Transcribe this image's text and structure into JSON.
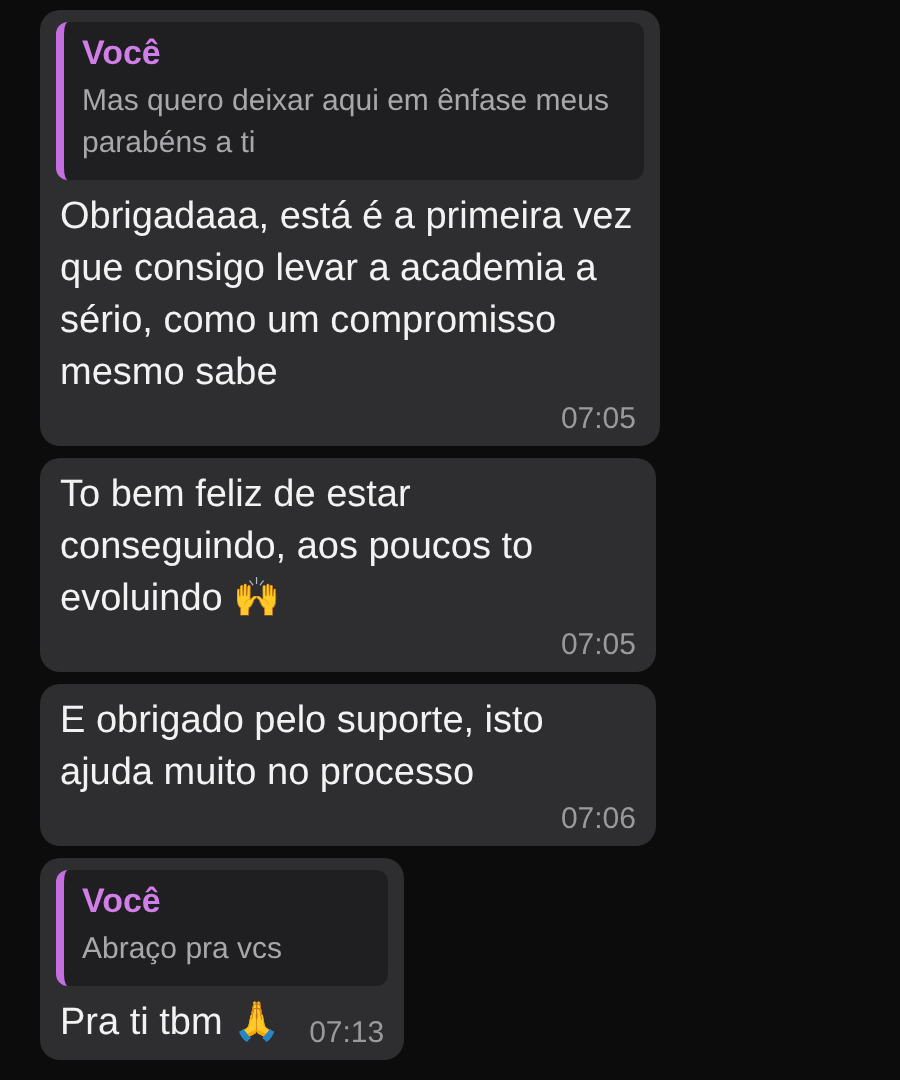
{
  "messages": [
    {
      "quote": {
        "author": "Você",
        "text": "Mas quero deixar aqui em ênfase meus parabéns a ti"
      },
      "text": "Obrigadaaa, está é a primeira vez que consigo levar a academia a sério, como um compromisso mesmo sabe",
      "time": "07:05"
    },
    {
      "text": "To bem feliz de estar conseguindo, aos poucos to evoluindo 🙌",
      "time": "07:05"
    },
    {
      "text": "E obrigado pelo suporte, isto ajuda muito no processo",
      "time": "07:06"
    },
    {
      "quote": {
        "author": "Você",
        "text": "Abraço pra vcs"
      },
      "text": "Pra ti tbm 🙏",
      "time": "07:13"
    }
  ]
}
